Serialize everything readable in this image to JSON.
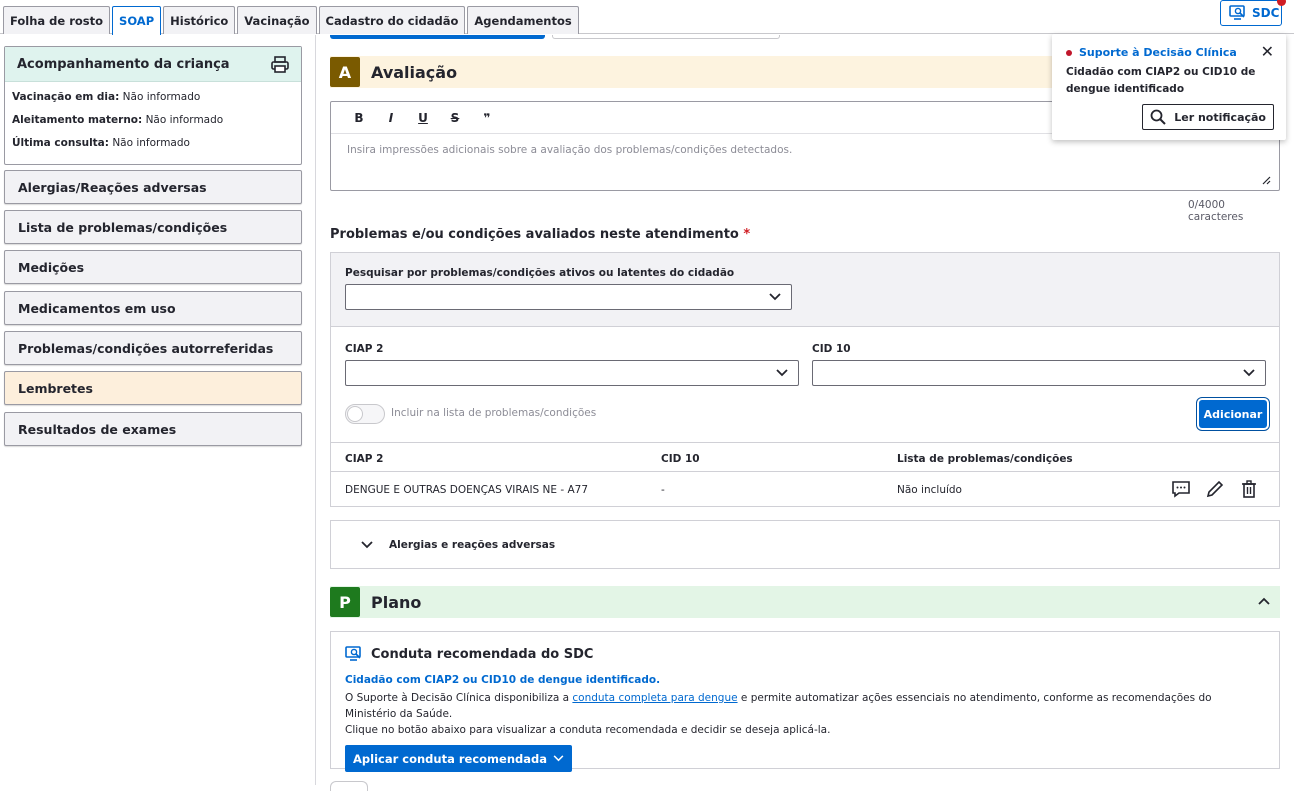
{
  "tabs": [
    "Folha de rosto",
    "SOAP",
    "Histórico",
    "Vacinação",
    "Cadastro do cidadão",
    "Agendamentos"
  ],
  "active_tab": "SOAP",
  "sdc_button": "SDC",
  "sidebar": {
    "child_card": {
      "title": "Acompanhamento da criança",
      "rows": [
        {
          "label": "Vacinação em dia:",
          "value": "Não informado"
        },
        {
          "label": "Aleitamento materno:",
          "value": "Não informado"
        },
        {
          "label": "Última consulta:",
          "value": "Não informado"
        }
      ]
    },
    "items": [
      "Alergias/Reações adversas",
      "Lista de problemas/condições",
      "Medições",
      "Medicamentos em uso",
      "Problemas/condições autorreferidas",
      "Lembretes",
      "Resultados de exames"
    ]
  },
  "avaliacao": {
    "badge": "A",
    "title": "Avaliação",
    "toolbar": [
      "B",
      "I",
      "U",
      "S",
      "❞"
    ],
    "placeholder": "Insira impressões adicionais sobre a avaliação dos problemas/condições detectados.",
    "counter": "0/4000 caracteres"
  },
  "problems": {
    "label": "Problemas e/ou condições avaliados neste atendimento",
    "required_mark": "*",
    "search_label": "Pesquisar por problemas/condições ativos ou latentes do cidadão",
    "ciap_label": "CIAP 2",
    "cid_label": "CID 10",
    "toggle_label": "Incluir na lista de problemas/condições",
    "add_button": "Adicionar",
    "table_headers": [
      "CIAP 2",
      "CID 10",
      "Lista de problemas/condições"
    ],
    "rows": [
      {
        "ciap": "DENGUE E OUTRAS DOENÇAS VIRAIS NE - A77",
        "cid": "-",
        "list": "Não incluído"
      }
    ]
  },
  "allergies_label": "Alergias e reações adversas",
  "plano": {
    "badge": "P",
    "title": "Plano"
  },
  "sdc_card": {
    "title": "Conduta recomendada do SDC",
    "subtitle": "Cidadão com CIAP2 ou CID10 de dengue identificado.",
    "text_before": "O Suporte à Decisão Clínica disponibiliza a ",
    "link": "conduta completa para dengue",
    "text_after": " e permite automatizar ações essenciais no atendimento, conforme as recomendações do Ministério da Saúde.",
    "text_line2": "Clique no botão abaixo para visualizar a conduta recomendada e decidir se deseja aplicá-la.",
    "button": "Aplicar conduta recomendada"
  },
  "notification": {
    "title": "Suporte à Decisão Clínica",
    "body": "Cidadão com CIAP2 ou CID10 de dengue identificado",
    "button": "Ler notificação"
  },
  "colors": {
    "primary": "#0069d0",
    "badge_a": "#7a5a00",
    "badge_p": "#1e7a1e",
    "alert": "#d01e24"
  }
}
